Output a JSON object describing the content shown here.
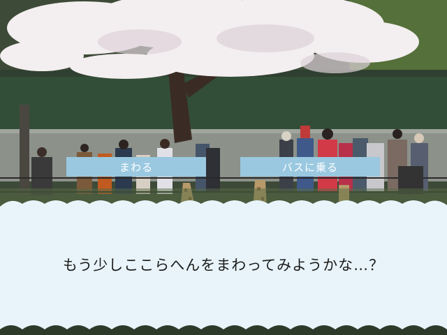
{
  "choices": [
    {
      "label": "まわる"
    },
    {
      "label": "バスに乗る"
    }
  ],
  "dialogue": {
    "text": "もう少しここらへんをまわってみようかな…？"
  },
  "colors": {
    "textbox_bg": "#e8f4fa",
    "choice_bg": "#9ac8e0",
    "choice_text": "#ffffff",
    "dialogue_text": "#1c1c1c"
  }
}
